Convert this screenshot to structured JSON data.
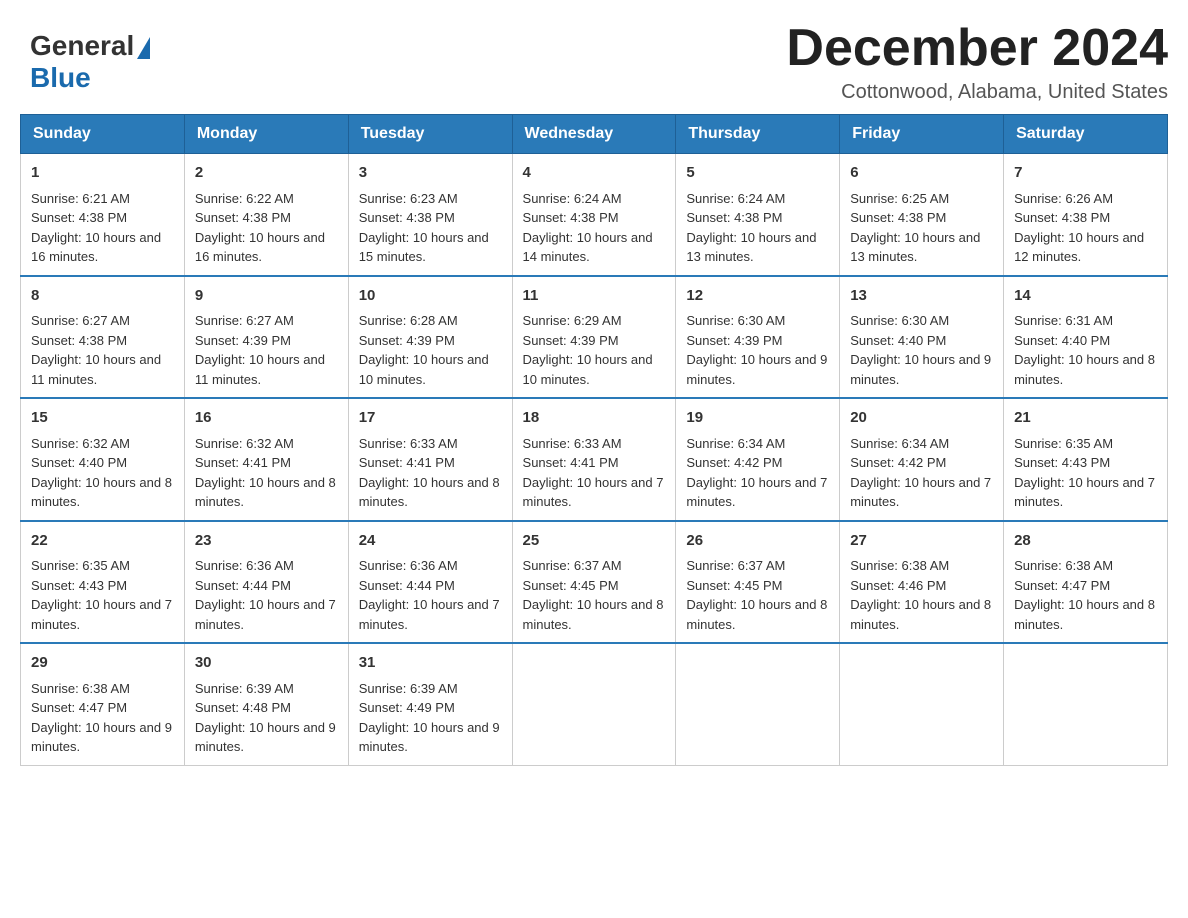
{
  "header": {
    "logo_general": "General",
    "logo_blue": "Blue",
    "month_title": "December 2024",
    "location": "Cottonwood, Alabama, United States"
  },
  "days_of_week": [
    "Sunday",
    "Monday",
    "Tuesday",
    "Wednesday",
    "Thursday",
    "Friday",
    "Saturday"
  ],
  "weeks": [
    [
      {
        "day": "1",
        "sunrise": "6:21 AM",
        "sunset": "4:38 PM",
        "daylight": "10 hours and 16 minutes."
      },
      {
        "day": "2",
        "sunrise": "6:22 AM",
        "sunset": "4:38 PM",
        "daylight": "10 hours and 16 minutes."
      },
      {
        "day": "3",
        "sunrise": "6:23 AM",
        "sunset": "4:38 PM",
        "daylight": "10 hours and 15 minutes."
      },
      {
        "day": "4",
        "sunrise": "6:24 AM",
        "sunset": "4:38 PM",
        "daylight": "10 hours and 14 minutes."
      },
      {
        "day": "5",
        "sunrise": "6:24 AM",
        "sunset": "4:38 PM",
        "daylight": "10 hours and 13 minutes."
      },
      {
        "day": "6",
        "sunrise": "6:25 AM",
        "sunset": "4:38 PM",
        "daylight": "10 hours and 13 minutes."
      },
      {
        "day": "7",
        "sunrise": "6:26 AM",
        "sunset": "4:38 PM",
        "daylight": "10 hours and 12 minutes."
      }
    ],
    [
      {
        "day": "8",
        "sunrise": "6:27 AM",
        "sunset": "4:38 PM",
        "daylight": "10 hours and 11 minutes."
      },
      {
        "day": "9",
        "sunrise": "6:27 AM",
        "sunset": "4:39 PM",
        "daylight": "10 hours and 11 minutes."
      },
      {
        "day": "10",
        "sunrise": "6:28 AM",
        "sunset": "4:39 PM",
        "daylight": "10 hours and 10 minutes."
      },
      {
        "day": "11",
        "sunrise": "6:29 AM",
        "sunset": "4:39 PM",
        "daylight": "10 hours and 10 minutes."
      },
      {
        "day": "12",
        "sunrise": "6:30 AM",
        "sunset": "4:39 PM",
        "daylight": "10 hours and 9 minutes."
      },
      {
        "day": "13",
        "sunrise": "6:30 AM",
        "sunset": "4:40 PM",
        "daylight": "10 hours and 9 minutes."
      },
      {
        "day": "14",
        "sunrise": "6:31 AM",
        "sunset": "4:40 PM",
        "daylight": "10 hours and 8 minutes."
      }
    ],
    [
      {
        "day": "15",
        "sunrise": "6:32 AM",
        "sunset": "4:40 PM",
        "daylight": "10 hours and 8 minutes."
      },
      {
        "day": "16",
        "sunrise": "6:32 AM",
        "sunset": "4:41 PM",
        "daylight": "10 hours and 8 minutes."
      },
      {
        "day": "17",
        "sunrise": "6:33 AM",
        "sunset": "4:41 PM",
        "daylight": "10 hours and 8 minutes."
      },
      {
        "day": "18",
        "sunrise": "6:33 AM",
        "sunset": "4:41 PM",
        "daylight": "10 hours and 7 minutes."
      },
      {
        "day": "19",
        "sunrise": "6:34 AM",
        "sunset": "4:42 PM",
        "daylight": "10 hours and 7 minutes."
      },
      {
        "day": "20",
        "sunrise": "6:34 AM",
        "sunset": "4:42 PM",
        "daylight": "10 hours and 7 minutes."
      },
      {
        "day": "21",
        "sunrise": "6:35 AM",
        "sunset": "4:43 PM",
        "daylight": "10 hours and 7 minutes."
      }
    ],
    [
      {
        "day": "22",
        "sunrise": "6:35 AM",
        "sunset": "4:43 PM",
        "daylight": "10 hours and 7 minutes."
      },
      {
        "day": "23",
        "sunrise": "6:36 AM",
        "sunset": "4:44 PM",
        "daylight": "10 hours and 7 minutes."
      },
      {
        "day": "24",
        "sunrise": "6:36 AM",
        "sunset": "4:44 PM",
        "daylight": "10 hours and 7 minutes."
      },
      {
        "day": "25",
        "sunrise": "6:37 AM",
        "sunset": "4:45 PM",
        "daylight": "10 hours and 8 minutes."
      },
      {
        "day": "26",
        "sunrise": "6:37 AM",
        "sunset": "4:45 PM",
        "daylight": "10 hours and 8 minutes."
      },
      {
        "day": "27",
        "sunrise": "6:38 AM",
        "sunset": "4:46 PM",
        "daylight": "10 hours and 8 minutes."
      },
      {
        "day": "28",
        "sunrise": "6:38 AM",
        "sunset": "4:47 PM",
        "daylight": "10 hours and 8 minutes."
      }
    ],
    [
      {
        "day": "29",
        "sunrise": "6:38 AM",
        "sunset": "4:47 PM",
        "daylight": "10 hours and 9 minutes."
      },
      {
        "day": "30",
        "sunrise": "6:39 AM",
        "sunset": "4:48 PM",
        "daylight": "10 hours and 9 minutes."
      },
      {
        "day": "31",
        "sunrise": "6:39 AM",
        "sunset": "4:49 PM",
        "daylight": "10 hours and 9 minutes."
      },
      null,
      null,
      null,
      null
    ]
  ],
  "labels": {
    "sunrise": "Sunrise:",
    "sunset": "Sunset:",
    "daylight": "Daylight:"
  }
}
